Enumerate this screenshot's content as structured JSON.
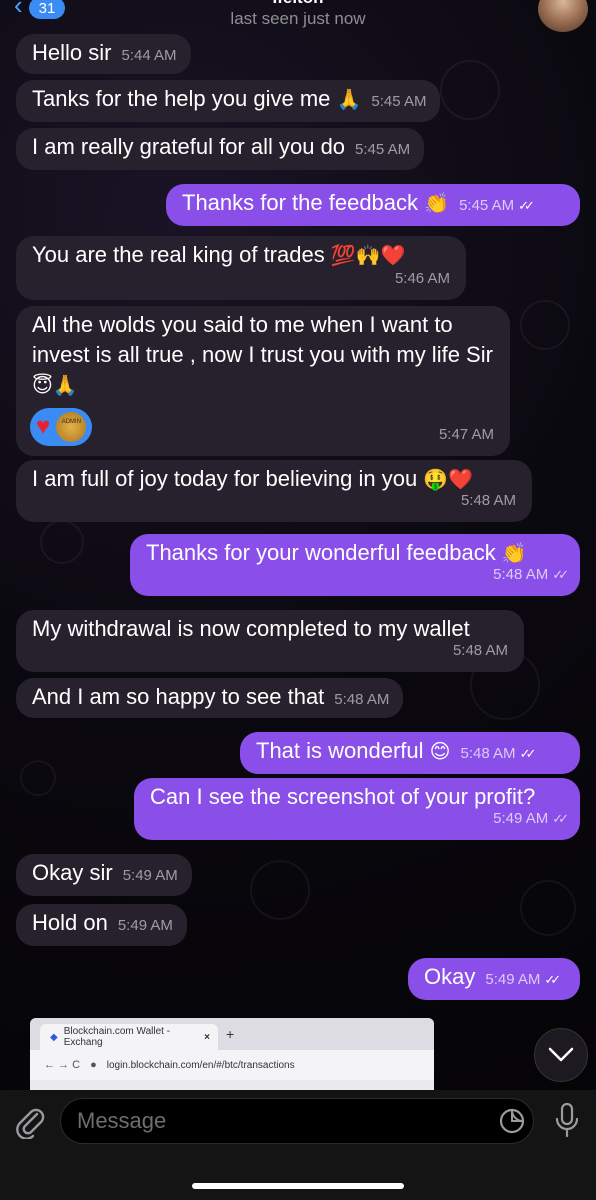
{
  "header": {
    "back_count": "31",
    "contact_name": "Ifelton",
    "status": "last seen just now"
  },
  "messages": [
    {
      "dir": "in",
      "text": "Hello sir",
      "emoji": "",
      "time": "5:44 AM"
    },
    {
      "dir": "in",
      "text": "Tanks for the help you give me",
      "emoji": "🙏",
      "time": "5:45 AM"
    },
    {
      "dir": "in",
      "text": "I am really grateful for all you do",
      "emoji": "",
      "time": "5:45 AM"
    },
    {
      "dir": "out",
      "text": "Thanks for the feedback",
      "emoji": "👏",
      "time": "5:45 AM"
    },
    {
      "dir": "in",
      "text": "You are the real king of trades",
      "emoji": "💯🙌❤️",
      "time": "5:46 AM"
    },
    {
      "dir": "in",
      "text": "All the wolds you said to me when I want to invest is all true , now I trust you with my life Sir",
      "emoji": "😇🙏",
      "time": "5:47 AM",
      "reactions": [
        "heart",
        "admin-coin"
      ],
      "reaction_badge_text": "ADMIN"
    },
    {
      "dir": "in",
      "text": "I am full of joy today for believing in you",
      "emoji": "🤑❤️",
      "time": "5:48 AM"
    },
    {
      "dir": "out",
      "text": "Thanks for your wonderful feedback",
      "emoji": "👏",
      "time": "5:48 AM"
    },
    {
      "dir": "in",
      "text": "My withdrawal is now completed to my wallet",
      "emoji": "",
      "time": "5:48 AM"
    },
    {
      "dir": "in",
      "text": "And I am so happy to see that",
      "emoji": "",
      "time": "5:48 AM"
    },
    {
      "dir": "out",
      "text": "That is wonderful",
      "emoji": "😊",
      "time": "5:48 AM"
    },
    {
      "dir": "out",
      "text": "Can I see the screenshot of your profit?",
      "emoji": "",
      "time": "5:49 AM"
    },
    {
      "dir": "in",
      "text": "Okay sir",
      "emoji": "",
      "time": "5:49 AM"
    },
    {
      "dir": "in",
      "text": "Hold on",
      "emoji": "",
      "time": "5:49 AM"
    },
    {
      "dir": "out",
      "text": "Okay",
      "emoji": "",
      "time": "5:49 AM"
    }
  ],
  "read_checks": "✓✓",
  "preview": {
    "tab_title": "Blockchain.com Wallet - Exchang",
    "tab_close": "×",
    "new_tab": "+",
    "nav": "← → C",
    "url": "login.blockchain.com/en/#/btc/transactions"
  },
  "composer": {
    "placeholder": "Message"
  },
  "colors": {
    "incoming_bubble": "#26212d",
    "outgoing_bubble": "#8a4fe8",
    "accent": "#3b8bf5"
  }
}
